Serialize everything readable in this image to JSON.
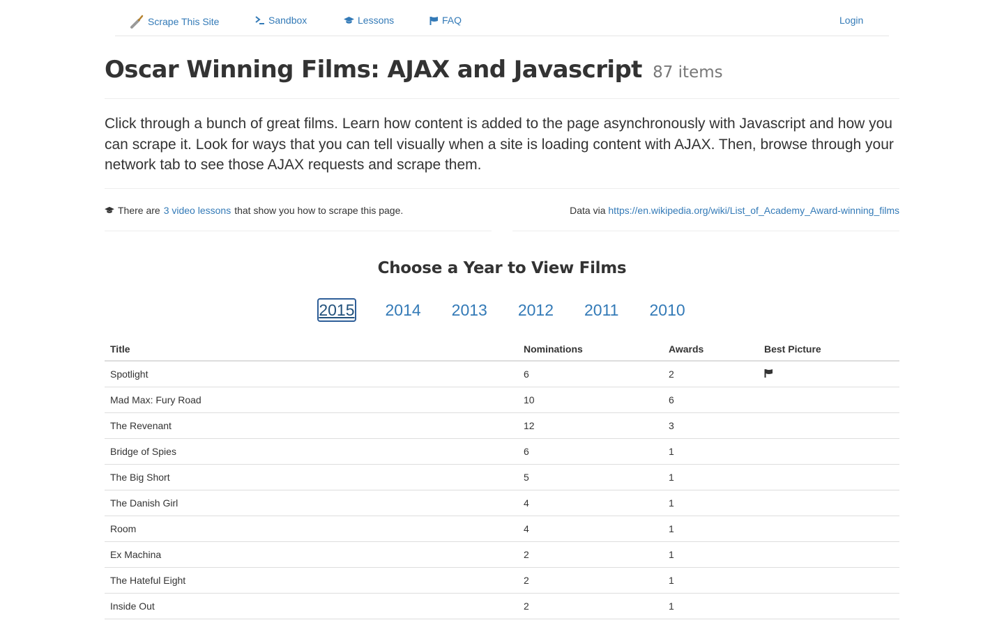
{
  "nav": {
    "brand_label": "Scrape This Site",
    "sandbox_label": "Sandbox",
    "lessons_label": "Lessons",
    "faq_label": "FAQ",
    "login_label": "Login"
  },
  "header": {
    "title": "Oscar Winning Films: AJAX and Javascript",
    "count": "87 items"
  },
  "lead": "Click through a bunch of great films. Learn how content is added to the page asynchronously with Javascript and how you can scrape it. Look for ways that you can tell visually when a site is loading content with AJAX. Then, browse through your network tab to see those AJAX requests and scrape them.",
  "info": {
    "prefix": "There are",
    "lessons_link": "3 video lessons",
    "suffix": "that show you how to scrape this page.",
    "data_via": "Data via",
    "source_link": "https://en.wikipedia.org/wiki/List_of_Academy_Award-winning_films"
  },
  "section_title": "Choose a Year to View Films",
  "years": [
    "2015",
    "2014",
    "2013",
    "2012",
    "2011",
    "2010"
  ],
  "selected_year": "2015",
  "table": {
    "headers": [
      "Title",
      "Nominations",
      "Awards",
      "Best Picture"
    ],
    "rows": [
      {
        "title": "Spotlight",
        "nominations": "6",
        "awards": "2",
        "best_picture": true
      },
      {
        "title": "Mad Max: Fury Road",
        "nominations": "10",
        "awards": "6",
        "best_picture": false
      },
      {
        "title": "The Revenant",
        "nominations": "12",
        "awards": "3",
        "best_picture": false
      },
      {
        "title": "Bridge of Spies",
        "nominations": "6",
        "awards": "1",
        "best_picture": false
      },
      {
        "title": "The Big Short",
        "nominations": "5",
        "awards": "1",
        "best_picture": false
      },
      {
        "title": "The Danish Girl",
        "nominations": "4",
        "awards": "1",
        "best_picture": false
      },
      {
        "title": "Room",
        "nominations": "4",
        "awards": "1",
        "best_picture": false
      },
      {
        "title": "Ex Machina",
        "nominations": "2",
        "awards": "1",
        "best_picture": false
      },
      {
        "title": "The Hateful Eight",
        "nominations": "2",
        "awards": "1",
        "best_picture": false
      },
      {
        "title": "Inside Out",
        "nominations": "2",
        "awards": "1",
        "best_picture": false
      }
    ]
  },
  "colors": {
    "link": "#337ab7",
    "text": "#333333",
    "muted": "#777777",
    "border": "#dddddd"
  }
}
